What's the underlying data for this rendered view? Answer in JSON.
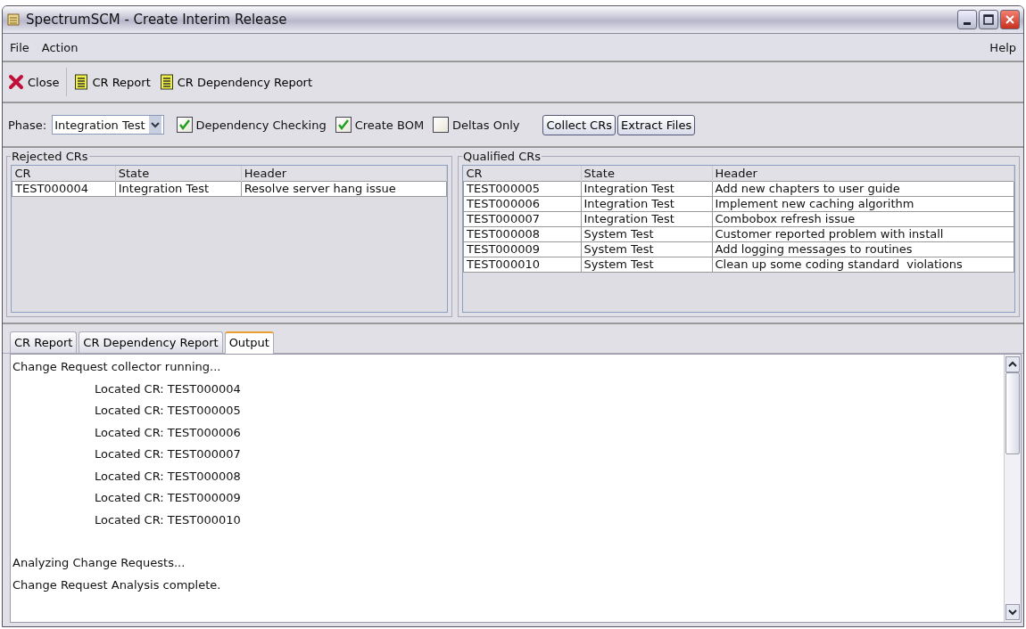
{
  "window": {
    "title": "SpectrumSCM - Create Interim Release"
  },
  "menu": {
    "left": [
      "File",
      "Action"
    ],
    "right": [
      "Help"
    ]
  },
  "toolbar": [
    {
      "kind": "close",
      "label": "Close"
    },
    {
      "kind": "report",
      "label": "CR Report"
    },
    {
      "kind": "report",
      "label": "CR Dependency Report"
    }
  ],
  "options": {
    "phase_label": "Phase:",
    "phase_value": "Integration Test",
    "checkboxes": [
      {
        "label": "Dependency Checking",
        "checked": true
      },
      {
        "label": "Create BOM",
        "checked": true
      },
      {
        "label": "Deltas Only",
        "checked": false
      }
    ],
    "buttons": [
      "Collect CRs",
      "Extract Files"
    ]
  },
  "rejected": {
    "title": "Rejected CRs",
    "columns": [
      "CR",
      "State",
      "Header"
    ],
    "rows": [
      [
        "TEST000004",
        "Integration Test",
        "Resolve server hang issue"
      ]
    ]
  },
  "qualified": {
    "title": "Qualified CRs",
    "columns": [
      "CR",
      "State",
      "Header"
    ],
    "rows": [
      [
        "TEST000005",
        "Integration Test",
        "Add new chapters to user guide"
      ],
      [
        "TEST000006",
        "Integration Test",
        "Implement new caching algorithm"
      ],
      [
        "TEST000007",
        "Integration Test",
        "Combobox refresh issue"
      ],
      [
        "TEST000008",
        "System Test",
        "Customer reported problem with install"
      ],
      [
        "TEST000009",
        "System Test",
        "Add logging messages to routines"
      ],
      [
        "TEST000010",
        "System Test",
        "Clean up some coding standard  violations"
      ]
    ]
  },
  "tabs": [
    {
      "label": "CR Report",
      "selected": false
    },
    {
      "label": "CR Dependency Report",
      "selected": false
    },
    {
      "label": "Output",
      "selected": true
    }
  ],
  "output": [
    {
      "text": "Change Request collector running...",
      "indent": false,
      "space_before": false
    },
    {
      "text": "Located CR: TEST000004",
      "indent": true,
      "space_before": false
    },
    {
      "text": "Located CR: TEST000005",
      "indent": true,
      "space_before": false
    },
    {
      "text": "Located CR: TEST000006",
      "indent": true,
      "space_before": false
    },
    {
      "text": "Located CR: TEST000007",
      "indent": true,
      "space_before": false
    },
    {
      "text": "Located CR: TEST000008",
      "indent": true,
      "space_before": false
    },
    {
      "text": "Located CR: TEST000009",
      "indent": true,
      "space_before": false
    },
    {
      "text": "Located CR: TEST000010",
      "indent": true,
      "space_before": false
    },
    {
      "text": "Analyzing Change Requests...",
      "indent": false,
      "space_before": true
    },
    {
      "text": "Change Request Analysis complete.",
      "indent": false,
      "space_before": false
    }
  ]
}
